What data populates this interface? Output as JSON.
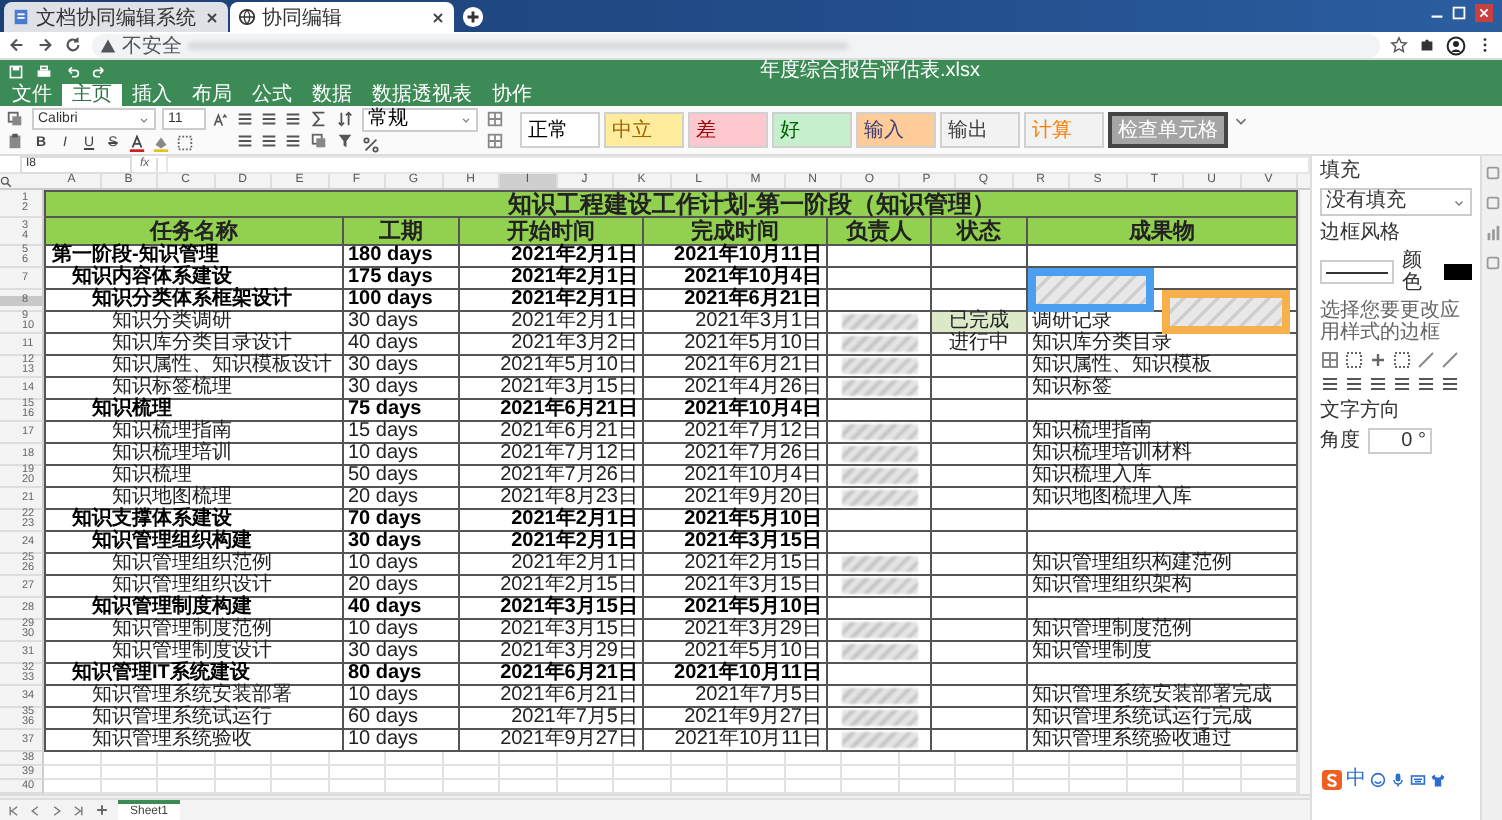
{
  "browser": {
    "tabs": [
      {
        "title": "文档协同编辑系统",
        "selected": false
      },
      {
        "title": "协同编辑",
        "selected": true
      }
    ],
    "security_label": "不安全"
  },
  "app": {
    "file_title": "年度综合报告评估表.xlsx",
    "menu": [
      {
        "label": "文件",
        "selected": false
      },
      {
        "label": "主页",
        "selected": true
      },
      {
        "label": "插入",
        "selected": false
      },
      {
        "label": "布局",
        "selected": false
      },
      {
        "label": "公式",
        "selected": false
      },
      {
        "label": "数据",
        "selected": false
      },
      {
        "label": "数据透视表",
        "selected": false
      },
      {
        "label": "协作",
        "selected": false
      }
    ]
  },
  "ribbon": {
    "font": "Calibri",
    "font_size": "11",
    "format_buttons": [
      "B",
      "I",
      "U",
      "S"
    ],
    "number_format": "常规",
    "cell_styles": [
      {
        "label": "正常",
        "kind": "normal",
        "color": "#ffffff"
      },
      {
        "label": "中立",
        "kind": "neutral",
        "color": "#ffeb9c"
      },
      {
        "label": "差",
        "kind": "bad",
        "color": "#ffc7ce"
      },
      {
        "label": "好",
        "kind": "good",
        "color": "#c6efce"
      },
      {
        "label": "输入",
        "kind": "input",
        "color": "#ffcc99"
      },
      {
        "label": "输出",
        "kind": "output",
        "color": "#f2f2f2"
      },
      {
        "label": "计算",
        "kind": "calculation",
        "color": "#f2f2f2"
      },
      {
        "label": "检查单元格",
        "kind": "check",
        "color": "#a5a5a5"
      }
    ]
  },
  "formula_bar": {
    "cell_ref": "I8",
    "fx": "fx"
  },
  "columns": [
    {
      "label": "A",
      "selected": false
    },
    {
      "label": "B",
      "selected": false
    },
    {
      "label": "C",
      "selected": false
    },
    {
      "label": "D",
      "selected": false
    },
    {
      "label": "E",
      "selected": false
    },
    {
      "label": "F",
      "selected": false
    },
    {
      "label": "G",
      "selected": false
    },
    {
      "label": "H",
      "selected": false
    },
    {
      "label": "I",
      "selected": true
    },
    {
      "label": "J",
      "selected": false
    },
    {
      "label": "K",
      "selected": false
    },
    {
      "label": "L",
      "selected": false
    },
    {
      "label": "M",
      "selected": false
    },
    {
      "label": "N",
      "selected": false
    },
    {
      "label": "O",
      "selected": false
    },
    {
      "label": "P",
      "selected": false
    },
    {
      "label": "Q",
      "selected": false
    },
    {
      "label": "R",
      "selected": false
    },
    {
      "label": "S",
      "selected": false
    },
    {
      "label": "T",
      "selected": false
    },
    {
      "label": "U",
      "selected": false
    },
    {
      "label": "V",
      "selected": false
    }
  ],
  "sheet": {
    "title": {
      "text": "知识工程建设工作计划-第一阶段（知识管理）",
      "row_numbers": [
        {
          "label": "1",
          "selected": false
        },
        {
          "label": "2",
          "selected": false
        }
      ]
    },
    "headers": {
      "labels": [
        "任务名称",
        "工期",
        "开始时间",
        "完成时间",
        "负责人",
        "状态",
        "成果物"
      ],
      "row_numbers": [
        {
          "label": "3",
          "selected": false
        },
        {
          "label": "4",
          "selected": false
        }
      ]
    },
    "rows": [
      {
        "name": "第一阶段-知识管理",
        "duration": "180 days",
        "start": "2021年2月1日",
        "end": "2021年10月11日",
        "row_numbers": [
          {
            "label": "5",
            "selected": false
          },
          {
            "label": "6",
            "selected": false
          }
        ],
        "children": [
          {
            "name": "知识内容体系建设",
            "duration": "175 days",
            "start": "2021年2月1日",
            "end": "2021年10月4日",
            "row_numbers": [
              {
                "label": "7",
                "selected": false
              }
            ],
            "children": [
              {
                "name": "知识分类体系框架设计",
                "duration": "100 days",
                "start": "2021年2月1日",
                "end": "2021年6月21日",
                "row_numbers": [
                  {
                    "label": "8",
                    "selected": true
                  }
                ],
                "children": [
                  {
                    "name": "知识分类调研",
                    "duration": "30 days",
                    "start": "2021年2月1日",
                    "end": "2021年3月1日",
                    "row_numbers": [
                      {
                        "label": "9",
                        "selected": false
                      },
                      {
                        "label": "10",
                        "selected": false
                      }
                    ],
                    "owner_redacted": true,
                    "status": {
                      "text": "已完成",
                      "color": "#dce9c9"
                    },
                    "result": "调研记录"
                  },
                  {
                    "name": "知识库分类目录设计",
                    "duration": "40 days",
                    "start": "2021年3月2日",
                    "end": "2021年5月10日",
                    "row_numbers": [
                      {
                        "label": "11",
                        "selected": false
                      }
                    ],
                    "owner_redacted": true,
                    "status": {
                      "text": "进行中"
                    },
                    "result": "知识库分类目录"
                  },
                  {
                    "name": "知识属性、知识模板设计",
                    "duration": "30 days",
                    "start": "2021年5月10日",
                    "end": "2021年6月21日",
                    "row_numbers": [
                      {
                        "label": "12",
                        "selected": false
                      },
                      {
                        "label": "13",
                        "selected": false
                      }
                    ],
                    "owner_redacted": true,
                    "result": "知识属性、知识模板"
                  },
                  {
                    "name": "知识标签梳理",
                    "duration": "30 days",
                    "start": "2021年3月15日",
                    "end": "2021年4月26日",
                    "row_numbers": [
                      {
                        "label": "14",
                        "selected": false
                      }
                    ],
                    "owner_redacted": true,
                    "result": "知识标签"
                  }
                ]
              },
              {
                "name": "知识梳理",
                "duration": "75 days",
                "start": "2021年6月21日",
                "end": "2021年10月4日",
                "row_numbers": [
                  {
                    "label": "15",
                    "selected": false
                  },
                  {
                    "label": "16",
                    "selected": false
                  }
                ],
                "children": [
                  {
                    "name": "知识梳理指南",
                    "duration": "15 days",
                    "start": "2021年6月21日",
                    "end": "2021年7月12日",
                    "row_numbers": [
                      {
                        "label": "17",
                        "selected": false
                      }
                    ],
                    "owner_redacted": true,
                    "result": "知识梳理指南"
                  },
                  {
                    "name": "知识梳理培训",
                    "duration": "10 days",
                    "start": "2021年7月12日",
                    "end": "2021年7月26日",
                    "row_numbers": [
                      {
                        "label": "18",
                        "selected": false
                      }
                    ],
                    "owner_redacted": true,
                    "result": "知识梳理培训材料"
                  },
                  {
                    "name": "知识梳理",
                    "duration": "50 days",
                    "start": "2021年7月26日",
                    "end": "2021年10月4日",
                    "row_numbers": [
                      {
                        "label": "19",
                        "selected": false
                      },
                      {
                        "label": "20",
                        "selected": false
                      }
                    ],
                    "owner_redacted": true,
                    "result": "知识梳理入库"
                  },
                  {
                    "name": "知识地图梳理",
                    "duration": "20 days",
                    "start": "2021年8月23日",
                    "end": "2021年9月20日",
                    "row_numbers": [
                      {
                        "label": "21",
                        "selected": false
                      }
                    ],
                    "owner_redacted": true,
                    "result": "知识地图梳理入库"
                  }
                ]
              }
            ]
          },
          {
            "name": "知识支撑体系建设",
            "duration": "70 days",
            "start": "2021年2月1日",
            "end": "2021年5月10日",
            "row_numbers": [
              {
                "label": "22",
                "selected": false
              },
              {
                "label": "23",
                "selected": false
              }
            ],
            "children": [
              {
                "name": "知识管理组织构建",
                "duration": "30 days",
                "start": "2021年2月1日",
                "end": "2021年3月15日",
                "row_numbers": [
                  {
                    "label": "24",
                    "selected": false
                  }
                ],
                "children": [
                  {
                    "name": "知识管理组织范例",
                    "duration": "10 days",
                    "start": "2021年2月1日",
                    "end": "2021年2月15日",
                    "row_numbers": [
                      {
                        "label": "25",
                        "selected": false
                      },
                      {
                        "label": "26",
                        "selected": false
                      }
                    ],
                    "owner_redacted": true,
                    "result": "知识管理组织构建范例"
                  },
                  {
                    "name": "知识管理组织设计",
                    "duration": "20 days",
                    "start": "2021年2月15日",
                    "end": "2021年3月15日",
                    "row_numbers": [
                      {
                        "label": "27",
                        "selected": false
                      }
                    ],
                    "owner_redacted": true,
                    "result": "知识管理组织架构"
                  }
                ]
              },
              {
                "name": "知识管理制度构建",
                "duration": "40 days",
                "start": "2021年3月15日",
                "end": "2021年5月10日",
                "row_numbers": [
                  {
                    "label": "28",
                    "selected": false
                  }
                ],
                "children": [
                  {
                    "name": "知识管理制度范例",
                    "duration": "10 days",
                    "start": "2021年3月15日",
                    "end": "2021年3月29日",
                    "row_numbers": [
                      {
                        "label": "29",
                        "selected": false
                      },
                      {
                        "label": "30",
                        "selected": false
                      }
                    ],
                    "owner_redacted": true,
                    "result": "知识管理制度范例"
                  },
                  {
                    "name": "知识管理制度设计",
                    "duration": "30 days",
                    "start": "2021年3月29日",
                    "end": "2021年5月10日",
                    "row_numbers": [
                      {
                        "label": "31",
                        "selected": false
                      }
                    ],
                    "owner_redacted": true,
                    "result": "知识管理制度"
                  }
                ]
              }
            ]
          },
          {
            "name": "知识管理IT系统建设",
            "duration": "80 days",
            "start": "2021年6月21日",
            "end": "2021年10月11日",
            "row_numbers": [
              {
                "label": "32",
                "selected": false
              },
              {
                "label": "33",
                "selected": false
              }
            ],
            "children": [
              {
                "name": "知识管理系统安装部署",
                "duration": "10 days",
                "start": "2021年6月21日",
                "end": "2021年7月5日",
                "row_numbers": [
                  {
                    "label": "34",
                    "selected": false
                  }
                ],
                "owner_redacted": true,
                "result": "知识管理系统安装部署完成"
              },
              {
                "name": "知识管理系统试运行",
                "duration": "60 days",
                "start": "2021年7月5日",
                "end": "2021年9月27日",
                "row_numbers": [
                  {
                    "label": "35",
                    "selected": false
                  },
                  {
                    "label": "36",
                    "selected": false
                  }
                ],
                "owner_redacted": true,
                "result": "知识管理系统试运行完成"
              },
              {
                "name": "知识管理系统验收",
                "duration": "10 days",
                "start": "2021年9月27日",
                "end": "2021年10月11日",
                "row_numbers": [
                  {
                    "label": "37",
                    "selected": false
                  }
                ],
                "owner_redacted": true,
                "result": "知识管理系统验收通过"
              }
            ]
          }
        ]
      }
    ],
    "empty_rows": [
      "38",
      "39",
      "40"
    ],
    "overlays": [
      {
        "color": "#4a9ff0"
      },
      {
        "color": "#f8b04a"
      }
    ]
  },
  "sheet_tabs": [
    {
      "label": "Sheet1",
      "selected": true
    }
  ],
  "format_panel": {
    "fill_label": "填充",
    "fill_value": "没有填充",
    "border_style_label": "边框风格",
    "color_label": "颜色",
    "border_color": {
      "color": "#000000"
    },
    "border_hint": "选择您要更改应用样式的边框",
    "text_direction_label": "文字方向",
    "angle_label": "角度",
    "angle_value": "0 °"
  },
  "ime": {
    "label": "中"
  }
}
